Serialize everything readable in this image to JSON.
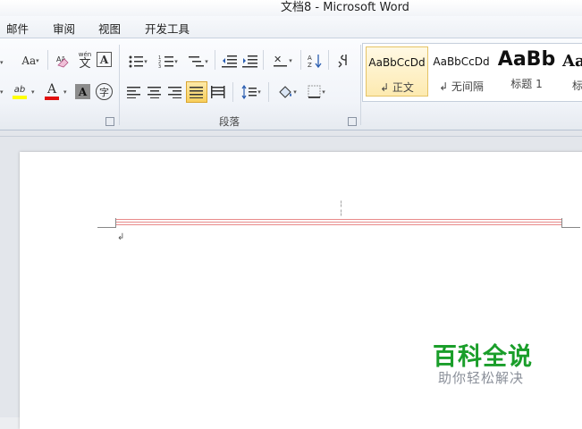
{
  "window": {
    "title": "文档8  -  Microsoft Word"
  },
  "tabs": [
    {
      "label": "邮件"
    },
    {
      "label": "审阅"
    },
    {
      "label": "视图"
    },
    {
      "label": "开发工具"
    }
  ],
  "ribbon": {
    "font_group": {
      "font_size_btn": "Aa",
      "char_border_btn": "A",
      "highlight_btn": "ab",
      "font_color_btn": "A",
      "char_shading_btn": "A",
      "enclose_btn": "字",
      "phonetic_btn": "wén",
      "phonetic_sub": "文"
    },
    "paragraph_group": {
      "label": "段落"
    },
    "styles": [
      {
        "sample": "AaBbCcDd",
        "name": "↲ 正文",
        "selected": true
      },
      {
        "sample": "AaBbCcDd",
        "name": "↲ 无间隔",
        "selected": false
      },
      {
        "sample": "AaBb",
        "name": "标题 1",
        "selected": false
      },
      {
        "sample": "Aa",
        "name": "标",
        "selected": false
      }
    ]
  },
  "document": {
    "paragraph_mark": "↲",
    "header_marks": "¦"
  },
  "watermark": {
    "title": "百科全说",
    "subtitle": "助你轻松解决"
  },
  "colors": {
    "highlight": "#ffff00",
    "font_color": "#e01010",
    "header_rule": "#e88a8a",
    "watermark_green": "#1a9e2a"
  }
}
